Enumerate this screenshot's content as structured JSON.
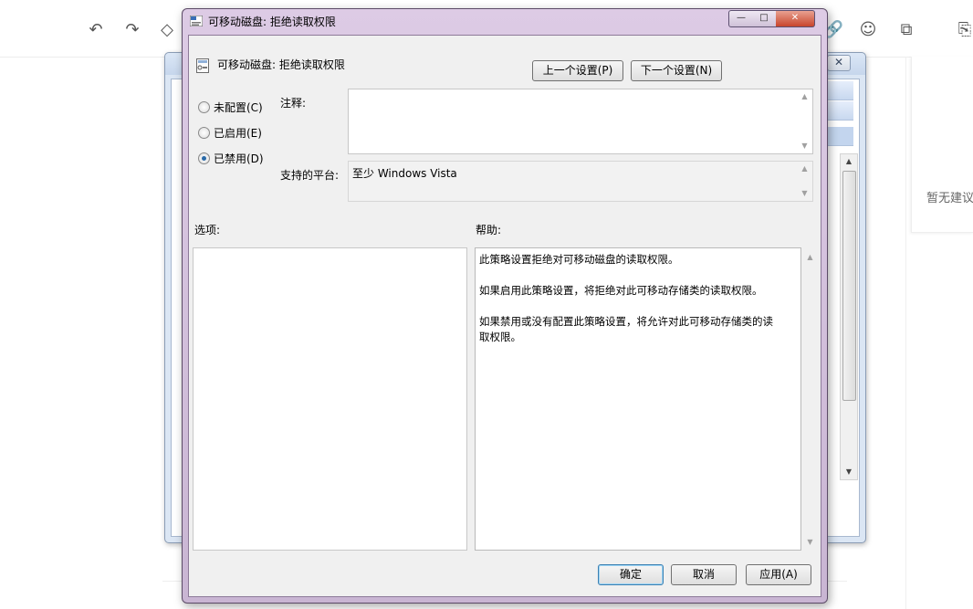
{
  "dialog": {
    "title": "可移动磁盘: 拒绝读取权限",
    "policy_name": "可移动磁盘: 拒绝读取权限",
    "prev_button": "上一个设置(P)",
    "next_button": "下一个设置(N)",
    "radio_options": [
      {
        "label": "未配置(C)",
        "checked": false
      },
      {
        "label": "已启用(E)",
        "checked": false
      },
      {
        "label": "已禁用(D)",
        "checked": true
      }
    ],
    "comment_label": "注释:",
    "comment_value": "",
    "platform_label": "支持的平台:",
    "platform_value": "至少 Windows Vista",
    "options_label": "选项:",
    "help_label": "帮助:",
    "help_paragraphs": [
      "此策略设置拒绝对可移动磁盘的读取权限。",
      "如果启用此策略设置，将拒绝对此可移动存储类的读取权限。",
      "如果禁用或没有配置此策略设置，将允许对此可移动存储类的读取权限。"
    ],
    "ok_button": "确定",
    "cancel_button": "取消",
    "apply_button": "应用(A)"
  },
  "background": {
    "side_panel_text": "暂无建议",
    "toolbar_icons": [
      "undo-icon",
      "redo-icon",
      "eraser-icon",
      "link-icon",
      "emoji-icon",
      "insert-icon",
      "export-icon"
    ]
  },
  "colors": {
    "dialog_frame": "#d6c3df",
    "close_button": "#c8452c",
    "radio_checked": "#2a6aa8"
  }
}
